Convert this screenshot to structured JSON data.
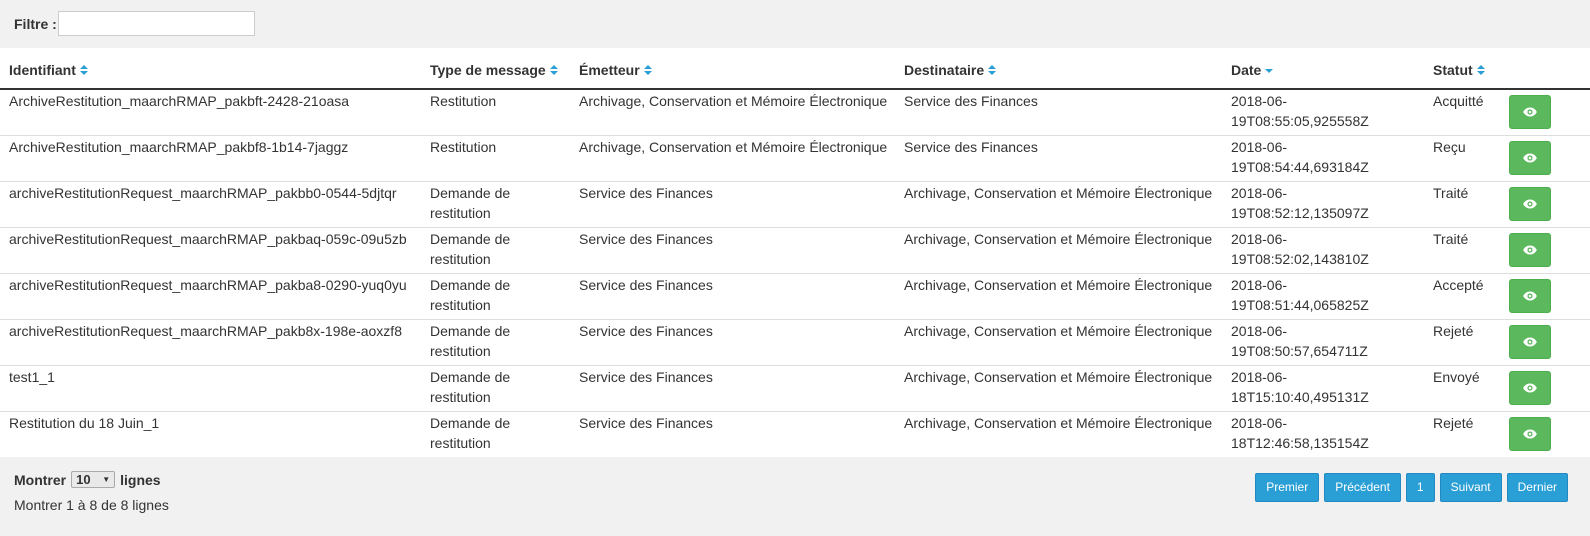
{
  "filter": {
    "label": "Filtre :",
    "value": "",
    "placeholder": ""
  },
  "table": {
    "columns": [
      {
        "label": "Identifiant",
        "sort": "both"
      },
      {
        "label": "Type de message",
        "sort": "both"
      },
      {
        "label": "Émetteur",
        "sort": "both"
      },
      {
        "label": "Destinataire",
        "sort": "both"
      },
      {
        "label": "Date",
        "sort": "desc"
      },
      {
        "label": "Statut",
        "sort": "both"
      }
    ],
    "rows": [
      {
        "id": "ArchiveRestitution_maarchRMAP_pakbft-2428-21oasa",
        "type": "Restitution",
        "sender": "Archivage, Conservation et Mémoire Électronique",
        "recipient": "Service des Finances",
        "date_line1": "2018-06-",
        "date_line2": "19T08:55:05,925558Z",
        "status": "Acquitté"
      },
      {
        "id": "ArchiveRestitution_maarchRMAP_pakbf8-1b14-7jaggz",
        "type": "Restitution",
        "sender": "Archivage, Conservation et Mémoire Électronique",
        "recipient": "Service des Finances",
        "date_line1": "2018-06-",
        "date_line2": "19T08:54:44,693184Z",
        "status": "Reçu"
      },
      {
        "id": "archiveRestitutionRequest_maarchRMAP_pakbb0-0544-5djtqr",
        "type": "Demande de restitution",
        "sender": "Service des Finances",
        "recipient": "Archivage, Conservation et Mémoire Électronique",
        "date_line1": "2018-06-",
        "date_line2": "19T08:52:12,135097Z",
        "status": "Traité"
      },
      {
        "id": "archiveRestitutionRequest_maarchRMAP_pakbaq-059c-09u5zb",
        "type": "Demande de restitution",
        "sender": "Service des Finances",
        "recipient": "Archivage, Conservation et Mémoire Électronique",
        "date_line1": "2018-06-",
        "date_line2": "19T08:52:02,143810Z",
        "status": "Traité"
      },
      {
        "id": "archiveRestitutionRequest_maarchRMAP_pakba8-0290-yuq0yu",
        "type": "Demande de restitution",
        "sender": "Service des Finances",
        "recipient": "Archivage, Conservation et Mémoire Électronique",
        "date_line1": "2018-06-",
        "date_line2": "19T08:51:44,065825Z",
        "status": "Accepté"
      },
      {
        "id": "archiveRestitutionRequest_maarchRMAP_pakb8x-198e-aoxzf8",
        "type": "Demande de restitution",
        "sender": "Service des Finances",
        "recipient": "Archivage, Conservation et Mémoire Électronique",
        "date_line1": "2018-06-",
        "date_line2": "19T08:50:57,654711Z",
        "status": "Rejeté"
      },
      {
        "id": "test1_1",
        "type": "Demande de restitution",
        "sender": "Service des Finances",
        "recipient": "Archivage, Conservation et Mémoire Électronique",
        "date_line1": "2018-06-",
        "date_line2": "18T15:10:40,495131Z",
        "status": "Envoyé"
      },
      {
        "id": "Restitution du 18 Juin_1",
        "type": "Demande de restitution",
        "sender": "Service des Finances",
        "recipient": "Archivage, Conservation et Mémoire Électronique",
        "date_line1": "2018-06-",
        "date_line2": "18T12:46:58,135154Z",
        "status": "Rejeté"
      }
    ],
    "action_icon": "eye-icon"
  },
  "footer": {
    "show_label": "Montrer",
    "rows_value": "10",
    "rows_suffix": "lignes",
    "info": "Montrer 1 à 8 de 8 lignes"
  },
  "pagination": {
    "first": "Premier",
    "previous": "Précédent",
    "page": "1",
    "next": "Suivant",
    "last": "Dernier"
  },
  "colors": {
    "view_button": "#5cb85c",
    "pager_button": "#2a9fd6",
    "sort_icon": "#2a9fd6"
  }
}
